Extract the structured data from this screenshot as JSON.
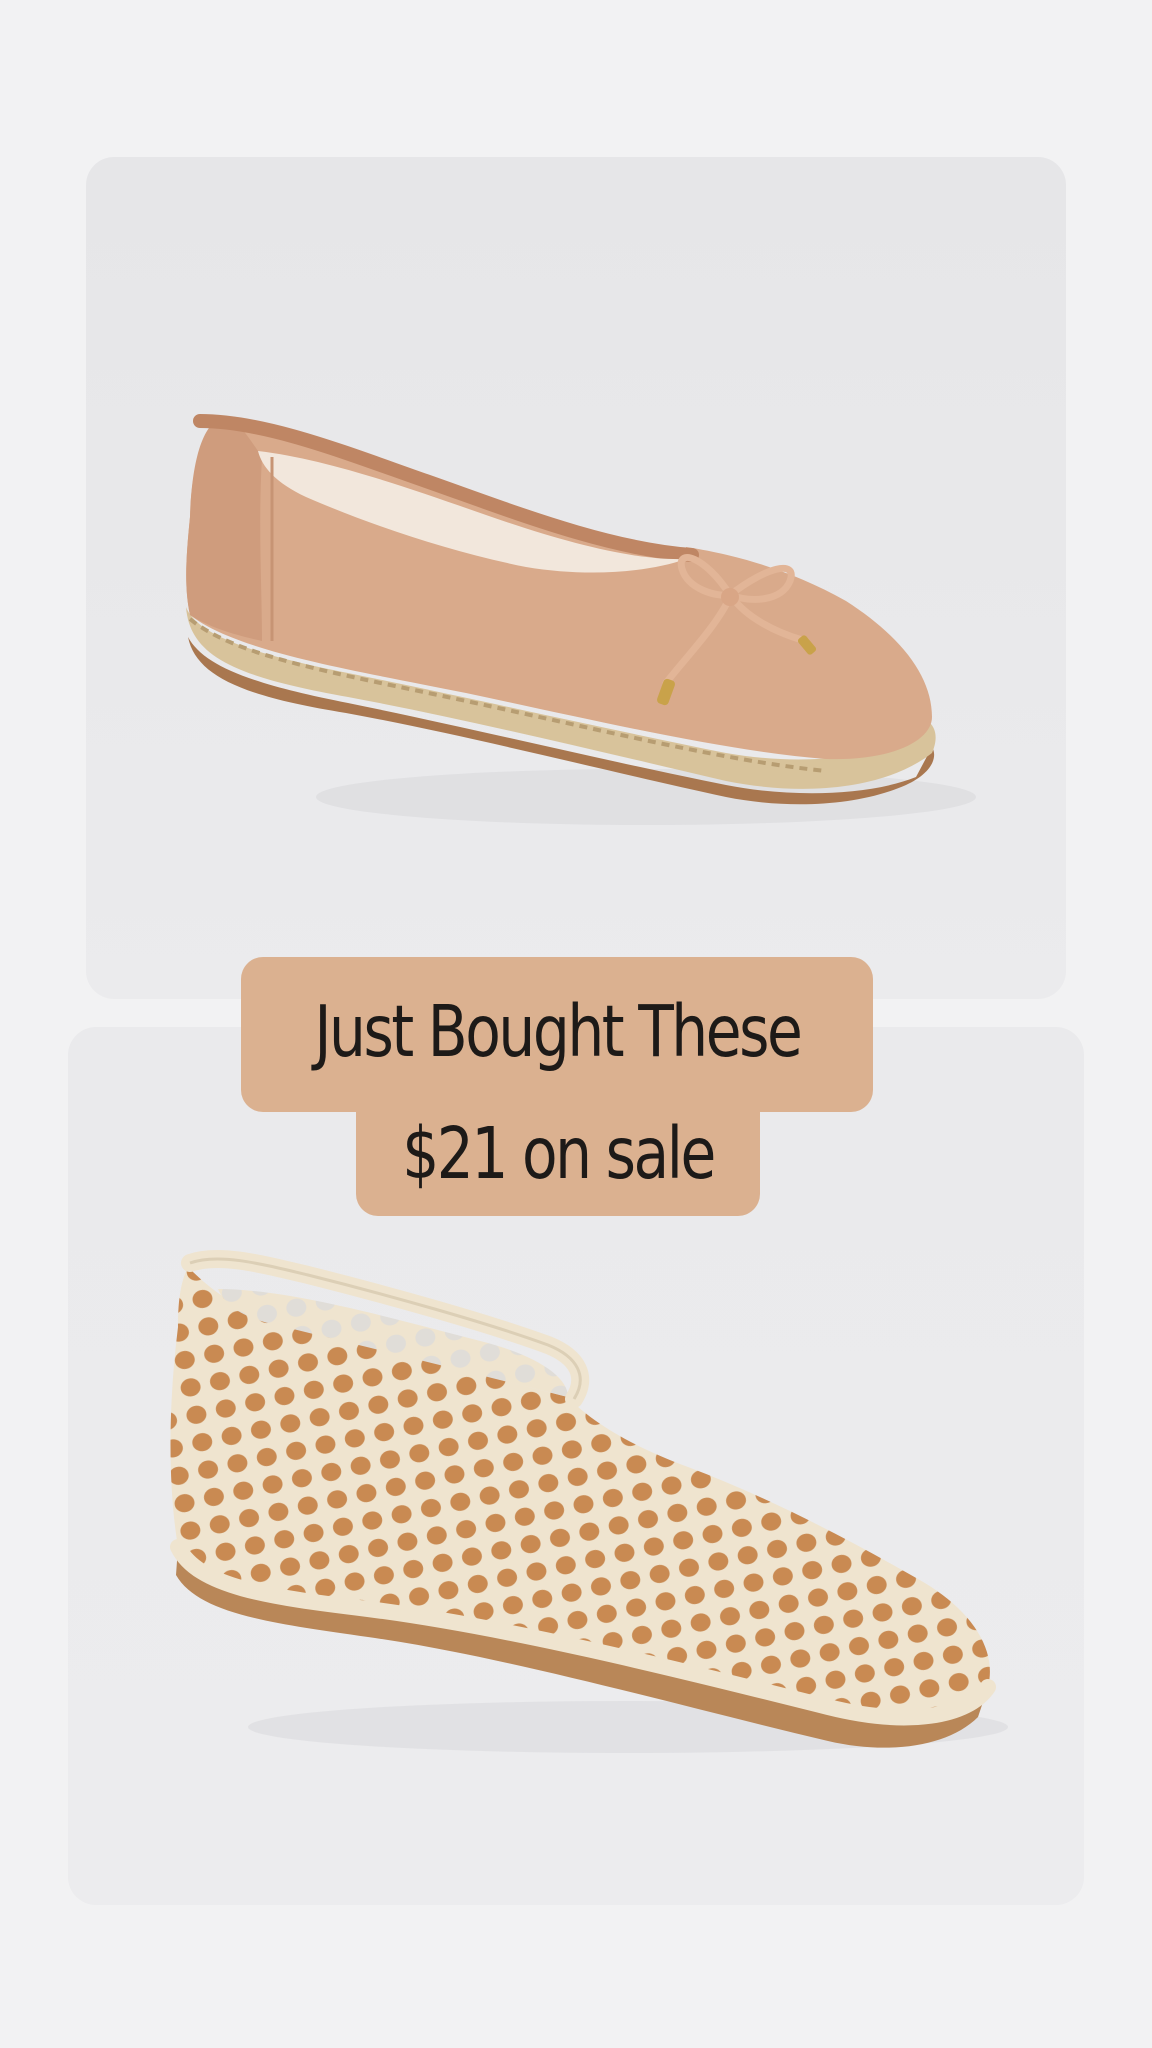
{
  "caption": {
    "line1": "Just Bought These",
    "line2": "$21 on sale",
    "background_color": "#dbb190",
    "text_color": "#1d1a18"
  },
  "products": [
    {
      "image": "tan-mesh-ballet-flat-with-bow-and-espadrille-sole",
      "color": "#d8a98a"
    },
    {
      "image": "cream-crochet-mesh-flat",
      "color": "#efe4cf"
    }
  ],
  "colors": {
    "page_background": "#f2f2f3",
    "card_background": "#e9e9eb"
  }
}
